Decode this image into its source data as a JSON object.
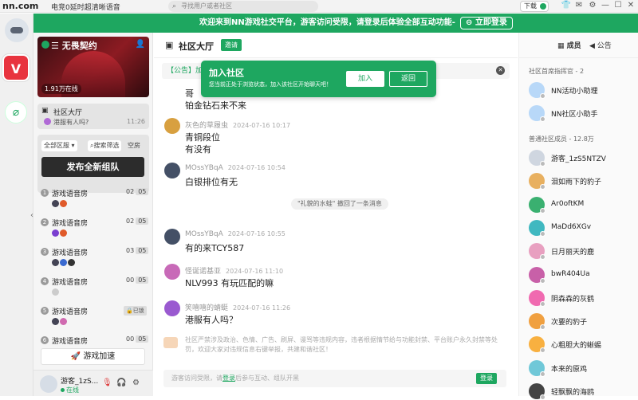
{
  "topbar": {
    "logo": "nn.com",
    "title": "电竞0延时超清晰语音",
    "search_placeholder": "寻找用户或者社区",
    "download": "下载"
  },
  "banner": {
    "text": "欢迎来到NN游戏社交平台，游客访问受限，请登录后体验全部互动功能-",
    "login": "立即登录"
  },
  "community": {
    "name": "无畏契约",
    "members": "1.91万在线",
    "lobby_title": "社区大厅",
    "lobby_last": "港服有人吗?",
    "lobby_time": "11:26"
  },
  "filters": {
    "region": "全部区服",
    "search": "搜索筛选",
    "empty": "空房",
    "new_team": "发布全新组队"
  },
  "rooms": [
    {
      "num": "1",
      "name": "游戏语音房",
      "count": "02",
      "cap": "05",
      "avatars": [
        "#445",
        "#e05a2a"
      ]
    },
    {
      "num": "2",
      "name": "游戏语音房",
      "count": "02",
      "cap": "05",
      "avatars": [
        "#7a3fd0",
        "#e05a2a"
      ]
    },
    {
      "num": "3",
      "name": "游戏语音房",
      "count": "03",
      "cap": "05",
      "avatars": [
        "#445",
        "#3a6ad0",
        "#333"
      ]
    },
    {
      "num": "4",
      "name": "游戏语音房",
      "count": "00",
      "cap": "05",
      "avatars": [
        "#ccc"
      ]
    },
    {
      "num": "5",
      "name": "游戏语音房",
      "locked": "已锁",
      "avatars": [
        "#445",
        "#d06ab0"
      ]
    },
    {
      "num": "6",
      "name": "游戏语音房",
      "count": "00",
      "cap": "05",
      "avatars": []
    }
  ],
  "accelerate": "游戏加速",
  "me": {
    "name": "游客_1zS...",
    "status": "在线"
  },
  "chat": {
    "title": "社区大厅",
    "invite": "邀请",
    "announcement": "【公告】加",
    "modal": {
      "title": "加入社区",
      "desc": "您当前正处于浏览状态，加入该社区开始聊天吧！",
      "join": "加入",
      "back": "返回"
    },
    "messages": [
      {
        "lines": [
          "哥",
          "铂金钻石来不来"
        ],
        "avatar": "",
        "name": "",
        "time": ""
      },
      {
        "name": "灰色的草履虫",
        "time": "2024-07-16 10:17",
        "lines": [
          "青铜段位",
          "有没有"
        ],
        "avatar": "#d8a040"
      },
      {
        "name": "MOssYBqA",
        "time": "2024-07-16 10:54",
        "lines": [
          "白银排位有无"
        ],
        "avatar": "#445066"
      },
      {
        "name": "MOssYBqA",
        "time": "2024-07-16 10:55",
        "lines": [
          "有的来TCY587"
        ],
        "avatar": "#445066"
      },
      {
        "name": "怪诞诺基亚",
        "time": "2024-07-16 11:10",
        "lines": [
          "NLV993 有玩匹配的嘛"
        ],
        "avatar": "#c86ab8"
      },
      {
        "name": "笑嘻嘻的蜻蜓",
        "time": "2024-07-16 11:26",
        "lines": [
          "港服有人吗？"
        ],
        "avatar": "#9a5ad0"
      }
    ],
    "system": "\"礼貌的水蛙\" 撤回了一条消息",
    "notice": "社区严禁涉及政治、色情、广告、刷屏、谩骂等违规内容，违者根据情节给与功能封禁、平台账户永久封禁等处罚，欢迎大家对违规信息右键举报，共建和谐社区！",
    "input_prefix": "游客访问受限，请",
    "input_link": "登录",
    "input_suffix": "后参与互动、组队开黑",
    "send": "登录"
  },
  "right": {
    "tab_members": "成员",
    "tab_notice": "公告",
    "admins_title": "社区首席指挥官 - 2",
    "admins": [
      {
        "name": "NN活动小助理",
        "color": "#b8d8f8"
      },
      {
        "name": "NN社区小助手",
        "color": "#b8d8f8"
      }
    ],
    "members_title": "普通社区成员 - 12.8万",
    "members": [
      {
        "name": "游客_1zS5NTZV",
        "color": "#cfd6e0"
      },
      {
        "name": "泪如雨下的豹子",
        "color": "#e8b060"
      },
      {
        "name": "Ar0oftKM",
        "color": "#3ab070"
      },
      {
        "name": "MaDd6XGv",
        "color": "#40b8c0"
      },
      {
        "name": "日月丽天的鹿",
        "color": "#e8a0c0"
      },
      {
        "name": "bwR404Ua",
        "color": "#c860a8"
      },
      {
        "name": "阴森森的灰鹤",
        "color": "#f06ab0"
      },
      {
        "name": "次要的豹子",
        "color": "#f0a040"
      },
      {
        "name": "心粗胆大的蜥蜴",
        "color": "#f8b040"
      },
      {
        "name": "本来的原鸡",
        "color": "#70c8d8"
      },
      {
        "name": "轻飘飘的海鸥",
        "color": "#444"
      }
    ]
  }
}
